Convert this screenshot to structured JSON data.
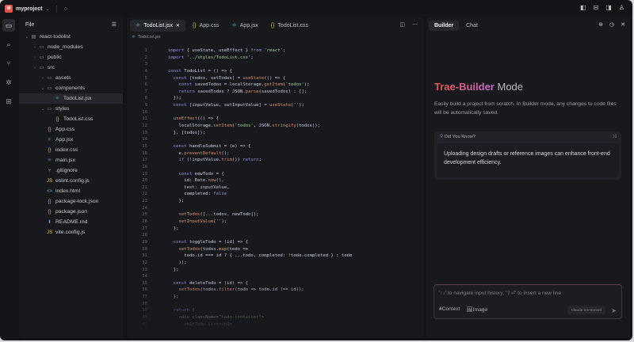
{
  "topbar": {
    "project": "myproject",
    "logo_letter": "M"
  },
  "activity": [
    "files",
    "search",
    "source-control",
    "debug",
    "extensions"
  ],
  "files": {
    "title": "File",
    "tree": [
      {
        "label": "react-todolist",
        "depth": 0,
        "type": "root",
        "open": true
      },
      {
        "label": "node_modules",
        "depth": 1,
        "type": "folder"
      },
      {
        "label": "public",
        "depth": 1,
        "type": "folder"
      },
      {
        "label": "src",
        "depth": 1,
        "type": "folder"
      },
      {
        "label": "assets",
        "depth": 2,
        "type": "folder"
      },
      {
        "label": "components",
        "depth": 2,
        "type": "folder",
        "open": true
      },
      {
        "label": "TodoList.jsx",
        "depth": 3,
        "type": "jsx",
        "selected": true
      },
      {
        "label": "styles",
        "depth": 2,
        "type": "folder",
        "open": true
      },
      {
        "label": "TodoList.css",
        "depth": 3,
        "type": "css"
      },
      {
        "label": "App.css",
        "depth": 2,
        "type": "css"
      },
      {
        "label": "App.jsx",
        "depth": 2,
        "type": "jsx"
      },
      {
        "label": "index.css",
        "depth": 2,
        "type": "css"
      },
      {
        "label": "main.jsx",
        "depth": 2,
        "type": "jsx"
      },
      {
        "label": ".gitignore",
        "depth": 2,
        "type": "git"
      },
      {
        "label": "eslint.config.js",
        "depth": 2,
        "type": "js"
      },
      {
        "label": "index.html",
        "depth": 2,
        "type": "html"
      },
      {
        "label": "package-lock.json",
        "depth": 2,
        "type": "json"
      },
      {
        "label": "package.json",
        "depth": 2,
        "type": "json"
      },
      {
        "label": "README.md",
        "depth": 2,
        "type": "md"
      },
      {
        "label": "vite.config.js",
        "depth": 2,
        "type": "js"
      }
    ]
  },
  "editor": {
    "tabs": [
      {
        "label": "TodoList.jsx",
        "type": "jsx",
        "active": true
      },
      {
        "label": "App.css",
        "type": "css"
      },
      {
        "label": "App.jsx",
        "type": "jsx"
      },
      {
        "label": "TodoList.css",
        "type": "css"
      }
    ],
    "breadcrumb": "TodoList.jsx",
    "lines": [
      "import { useState, useEffect } from 'react';",
      "import '../styles/TodoList.css';",
      "",
      "const TodoList = () => {",
      "  const [todos, setTodos] = useState(() => {",
      "    const savedTodos = localStorage.getItem('todos');",
      "    return savedTodos ? JSON.parse(savedTodos) : [];",
      "  });",
      "  const [inputValue, setInputValue] = useState('');",
      "",
      "  useEffect(() => {",
      "    localStorage.setItem('todos', JSON.stringify(todos));",
      "  }, [todos]);",
      "",
      "  const handleSubmit = (e) => {",
      "    e.preventDefault();",
      "    if (!inputValue.trim()) return;",
      "",
      "    const newTodo = {",
      "      id: Date.now(),",
      "      text: inputValue,",
      "      completed: false",
      "    };",
      "",
      "    setTodos([...todos, newTodo]);",
      "    setInputValue('');",
      "  };",
      "",
      "  const toggleTodo = (id) => {",
      "    setTodos(todos.map(todo =>",
      "      todo.id === id ? { ...todo, completed: !todo.completed } : todo",
      "    ));",
      "  };",
      "",
      "  const deleteTodo = (id) => {",
      "    setTodos(todos.filter(todo => todo.id !== id));",
      "  };",
      "",
      "  return (",
      "    <div className=\"todo-container\">",
      "      <h1>Todo List</h1>"
    ]
  },
  "builder": {
    "tabs": [
      "Builder",
      "Chat"
    ],
    "title_brand": "Trae-Builder",
    "title_rest": "Mode",
    "description": "Easily build a project from scratch. In Builder mode, any changes to code files will be automatically saved.",
    "tip_title": "Did You Know?",
    "tip_body": "Uploading design drafts or reference images can enhance front-end development efficiency.",
    "input_placeholder": "'↑↓' to navigate input history, '⇧⏎' to insert a new line",
    "context_label": "Context",
    "image_label": "Image",
    "model": "Claude 3.5-Sonnet"
  }
}
